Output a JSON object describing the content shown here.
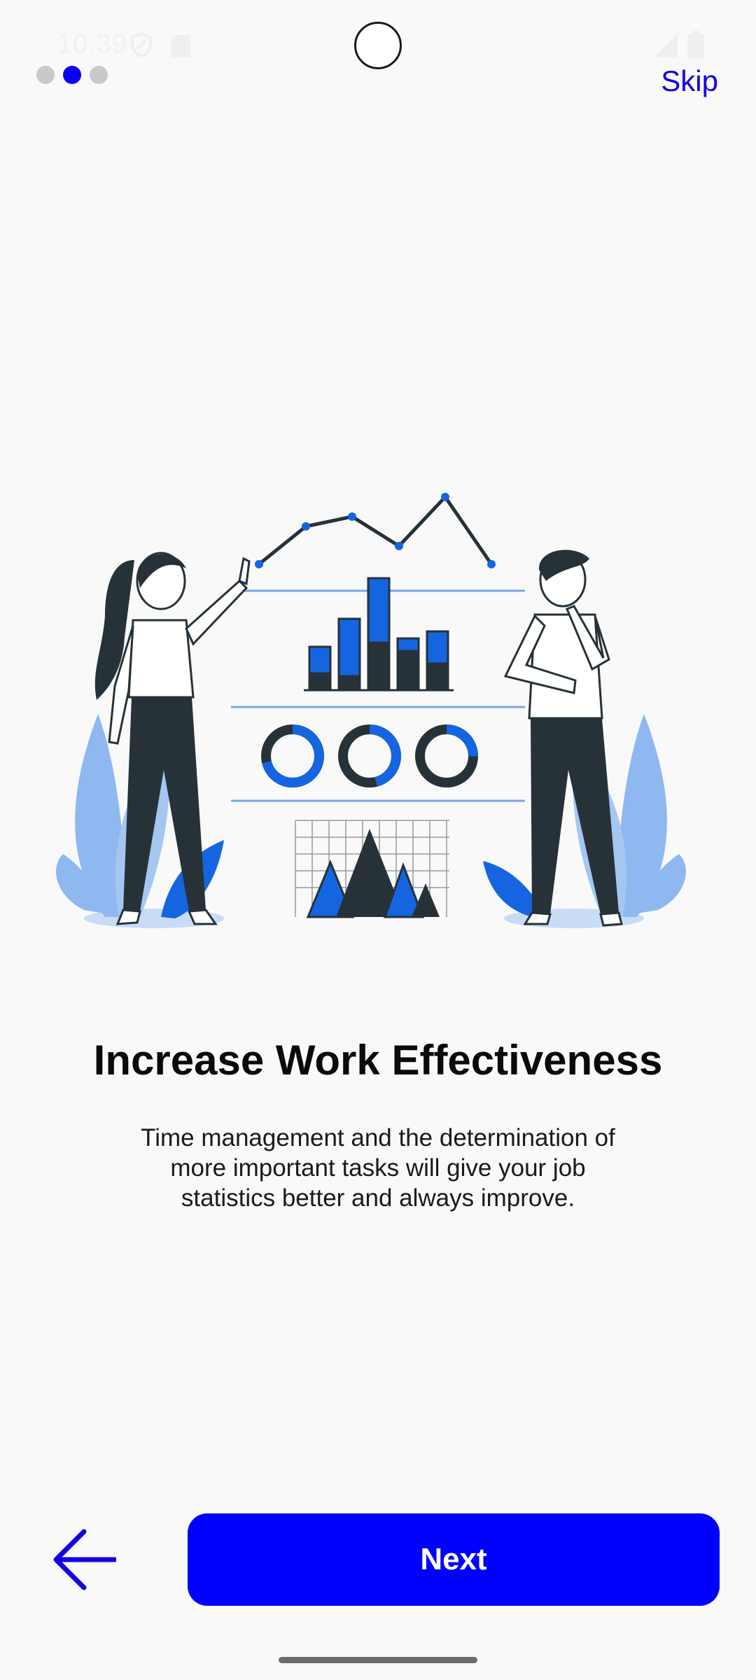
{
  "status_bar": {
    "time": "10:39",
    "icons": [
      "vpn-shield-icon",
      "sim-card-icon",
      "signal-icon",
      "battery-icon"
    ]
  },
  "onboarding": {
    "total_pages": 3,
    "current_page": 2,
    "skip_label": "Skip",
    "title": "Increase Work Effectiveness",
    "description": "Time management and the determination of more important tasks will give your job statistics better and always improve.",
    "next_label": "Next",
    "back_icon": "arrow-left-icon"
  },
  "illustration": {
    "name": "analytics-dashboard-illustration",
    "colors": {
      "accent": "#1565e0",
      "accent_light": "#8fb8f0",
      "dark": "#263238",
      "line": "#3d7be0"
    }
  },
  "colors": {
    "primary": "#0000ff",
    "link": "#1400e6",
    "dot_inactive": "#c9c9cc",
    "background": "#f9f9fa"
  }
}
